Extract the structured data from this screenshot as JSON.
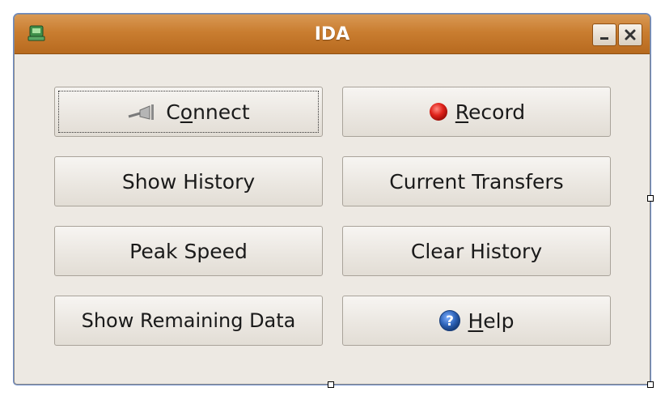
{
  "window": {
    "title": "IDA",
    "app_icon": "terminal-icon",
    "controls": {
      "minimize_icon": "minimize-icon",
      "close_icon": "close-icon"
    }
  },
  "buttons": {
    "connect": {
      "pre": "C",
      "mnemonic": "o",
      "post": "nnect",
      "icon": "plug-icon"
    },
    "record": {
      "pre": "",
      "mnemonic": "R",
      "post": "ecord",
      "icon": "record-icon",
      "icon_color": "#d9201a"
    },
    "show_history": {
      "label": "Show History"
    },
    "current_transfers": {
      "label": "Current Transfers"
    },
    "peak_speed": {
      "label": "Peak Speed"
    },
    "clear_history": {
      "label": "Clear History"
    },
    "show_remaining": {
      "label": "Show Remaining Data"
    },
    "help": {
      "pre": "",
      "mnemonic": "H",
      "post": "elp",
      "icon": "help-icon",
      "icon_color": "#2d63b8"
    }
  },
  "colors": {
    "titlebar": "#c97d30",
    "window_bg": "#ede9e3"
  }
}
